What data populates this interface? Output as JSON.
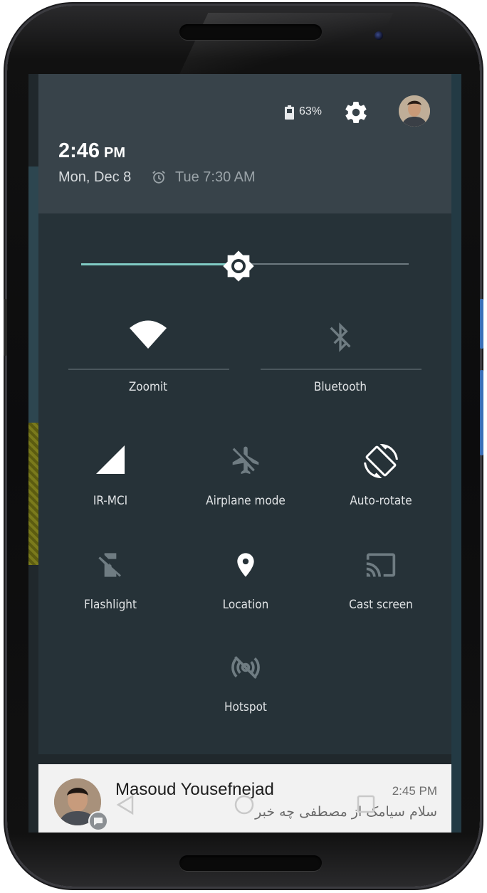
{
  "status": {
    "battery_percent": "63%",
    "battery_level": 0.63
  },
  "clock": {
    "time": "2:46",
    "ampm": "PM",
    "date": "Mon, Dec 8",
    "alarm": "Tue 7:30 AM"
  },
  "brightness": {
    "level": 0.48
  },
  "tiles": {
    "wifi": {
      "label": "Zoomit",
      "state": "on"
    },
    "bluetooth": {
      "label": "Bluetooth",
      "state": "off"
    },
    "cellular": {
      "label": "IR-MCI",
      "state": "on"
    },
    "airplane": {
      "label": "Airplane mode",
      "state": "off"
    },
    "autorotate": {
      "label": "Auto-rotate",
      "state": "on"
    },
    "flashlight": {
      "label": "Flashlight",
      "state": "off"
    },
    "location": {
      "label": "Location",
      "state": "on"
    },
    "cast": {
      "label": "Cast screen",
      "state": "off"
    },
    "hotspot": {
      "label": "Hotspot",
      "state": "off"
    }
  },
  "notification": {
    "sender": "Masoud Yousefnejad",
    "time": "2:45 PM",
    "message": "سلام سیامک از مصطفی چه خبر"
  },
  "icons": [
    "battery-icon",
    "settings-icon",
    "avatar",
    "alarm-icon",
    "brightness-icon",
    "wifi-icon",
    "bluetooth-off-icon",
    "cell-signal-icon",
    "airplane-off-icon",
    "rotate-icon",
    "flashlight-off-icon",
    "location-icon",
    "cast-icon",
    "hotspot-off-icon",
    "back-icon",
    "home-icon",
    "recents-icon",
    "chat-badge-icon"
  ],
  "colors": {
    "header": "#38434a",
    "shade": "#263238",
    "accent": "#80cbc4",
    "tile_on": "#ffffff",
    "tile_off": "#6f7c82"
  }
}
